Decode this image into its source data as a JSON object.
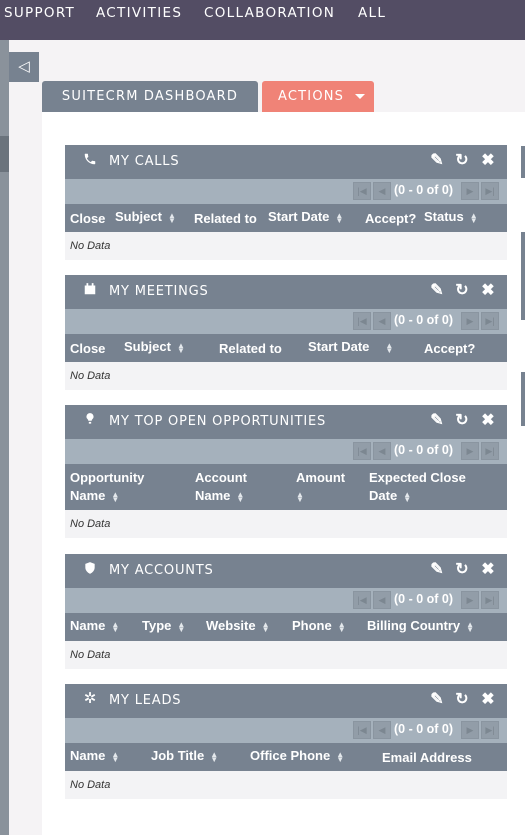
{
  "nav": {
    "items": [
      "SUPPORT",
      "ACTIVITIES",
      "COLLABORATION",
      "ALL"
    ]
  },
  "toggle": {
    "glyph": "◁"
  },
  "tabs": {
    "dashboard": "SUITECRM DASHBOARD",
    "actions": "ACTIONS"
  },
  "common": {
    "pagination": "(0 - 0 of 0)",
    "no_data": "No Data"
  },
  "dashlets": [
    {
      "title": "MY CALLS",
      "icon": "phone-icon",
      "columns": [
        "Close",
        "Subject",
        "Related to",
        "Start Date",
        "Accept?",
        "Status"
      ]
    },
    {
      "title": "MY MEETINGS",
      "icon": "calendar-icon",
      "columns": [
        "Close",
        "Subject",
        "Related to",
        "Start Date",
        "Accept?"
      ]
    },
    {
      "title": "MY TOP OPEN OPPORTUNITIES",
      "icon": "lightbulb-icon",
      "columns": [
        "Opportunity Name",
        "Account Name",
        "Amount",
        "Expected Close Date"
      ]
    },
    {
      "title": "MY ACCOUNTS",
      "icon": "shield-icon",
      "columns": [
        "Name",
        "Type",
        "Website",
        "Phone",
        "Billing Country"
      ]
    },
    {
      "title": "MY LEADS",
      "icon": "gear-icon",
      "columns": [
        "Name",
        "Job Title",
        "Office Phone",
        "Email Address"
      ]
    }
  ]
}
